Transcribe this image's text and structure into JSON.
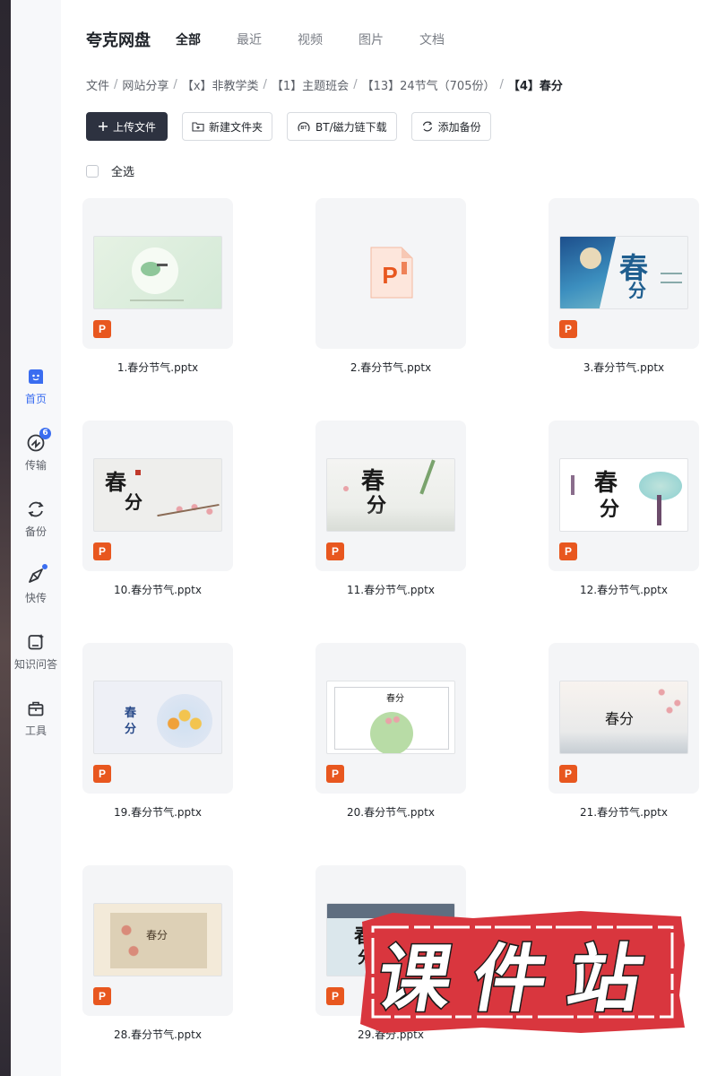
{
  "app": {
    "brand": "夸克网盘"
  },
  "tabs": [
    {
      "label": "全部"
    },
    {
      "label": "最近"
    },
    {
      "label": "视频"
    },
    {
      "label": "图片"
    },
    {
      "label": "文档"
    }
  ],
  "sidebar": {
    "items": [
      {
        "label": "首页",
        "icon": "home-icon"
      },
      {
        "label": "传输",
        "icon": "transfer-icon",
        "badge": "6"
      },
      {
        "label": "备份",
        "icon": "backup-icon"
      },
      {
        "label": "快传",
        "icon": "quick-send-icon"
      },
      {
        "label": "知识问答",
        "icon": "knowledge-qa-icon"
      },
      {
        "label": "工具",
        "icon": "tools-icon"
      }
    ]
  },
  "breadcrumb": [
    "文件",
    "网站分享",
    "【x】非教学类",
    "【1】主题班会",
    "【13】24节气（705份）",
    "【4】春分"
  ],
  "toolbar": {
    "upload": "上传文件",
    "new_folder": "新建文件夹",
    "bt_download": "BT/磁力链下载",
    "add_backup": "添加备份"
  },
  "select_all": "全选",
  "files": [
    {
      "name": "1.春分节气.pptx"
    },
    {
      "name": "2.春分节气.pptx"
    },
    {
      "name": "3.春分节气.pptx"
    },
    {
      "name": "10.春分节气.pptx"
    },
    {
      "name": "11.春分节气.pptx"
    },
    {
      "name": "12.春分节气.pptx"
    },
    {
      "name": "19.春分节气.pptx"
    },
    {
      "name": "20.春分节气.pptx"
    },
    {
      "name": "21.春分节气.pptx"
    },
    {
      "name": "28.春分节气.pptx"
    },
    {
      "name": "29.春分.pptx"
    }
  ],
  "slide_text": {
    "chun": "春",
    "fen": "分",
    "chunfen": "春分"
  },
  "file_type_tag": "P",
  "watermark": "课件站",
  "colors": {
    "accent": "#3a6df0",
    "ppt_orange": "#e8571f",
    "primary_button": "#2d3240",
    "watermark_red": "#d9363e"
  }
}
